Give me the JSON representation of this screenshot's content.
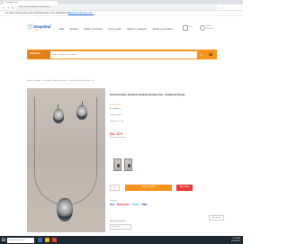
{
  "browser": {
    "tab_title": "Snapdeal.com",
    "url": "https://www.snapdeal.com/product/...",
    "bookmark_text": "For quick access, place your bookmarks here on the bookmarks bar.",
    "bookmark_link": "Manage bookmarks now..."
  },
  "site": {
    "logo_text": "Snapdeal",
    "logo_sub": "Unbox",
    "nav": [
      "MEN",
      "WOMEN",
      "HOME & KITCHEN",
      "TOYS & KIDS",
      "BEAUTY & HEALTH",
      "SPORTS & FITNESS"
    ],
    "header_right": {
      "cart_label": "Cart",
      "signin_label": "Sign In",
      "signin_sub": "Shop now"
    },
    "category_label": "Categories",
    "search_placeholder": "Search products & brands",
    "search_icon": "search-icon",
    "menu_icon": "menu-icon"
  },
  "breadcrumb": "Home > Women > Jewellery > Necklace Sets > Oxidised Silver Necklace Set",
  "product": {
    "title": "Oxidised Silver Jhumki & Pendant Necklace Set - Traditional Design",
    "stars": "★★★★★",
    "rating_text": "No ratings yet",
    "seller": "Sold by: Marva",
    "delivery": "Delivery: 5-7 days",
    "price": "Rs. 279",
    "price_note": "Inclusive of all taxes",
    "qty": "1",
    "add_to_cart": "ADD TO CART",
    "buy_now": "BUY NOW",
    "pay_label": "Pay with",
    "payments": [
      "Visa",
      "Mastercard",
      "Paytm",
      "VISA"
    ],
    "ask_question": "Have a Question?",
    "help_placeholder": "Search help",
    "chat_label": "Chat with us"
  },
  "taskbar": {
    "search_placeholder": "Type here to search",
    "time": "10:42 AM",
    "date": "12/05/2019"
  },
  "colors": {
    "accent": "#f7941d",
    "brand": "#1565c0",
    "danger": "#e53935"
  }
}
